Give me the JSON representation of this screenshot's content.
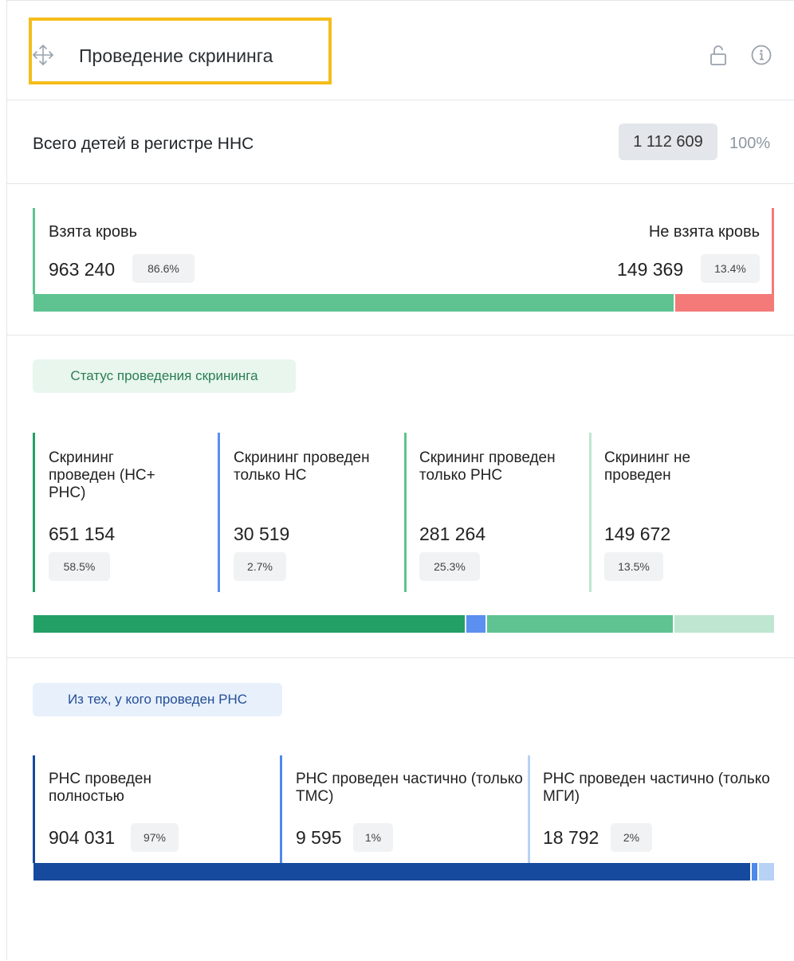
{
  "header": {
    "title": "Проведение скрининга",
    "icons": [
      "move-icon",
      "unlock-icon",
      "info-icon"
    ]
  },
  "total": {
    "label": "Всего детей в регистре ННС",
    "value": "1 112 609",
    "percent": "100%"
  },
  "blood": {
    "taken": {
      "label": "Взята кровь",
      "value": "963 240",
      "percent": "86.6%",
      "share": 0.866,
      "color": "#5ec391"
    },
    "not_taken": {
      "label": "Не взята кровь",
      "value": "149 369",
      "percent": "13.4%",
      "share": 0.134,
      "color": "#f47a7a"
    }
  },
  "screening_status": {
    "tag": "Статус проведения скрининга",
    "cards": [
      {
        "label": "Скрининг проведен (НС+ РНС)",
        "value": "651 154",
        "percent": "58.5%",
        "share": 0.585,
        "color": "#23a066"
      },
      {
        "label": "Скрининг проведен только НС",
        "value": "30 519",
        "percent": "2.7%",
        "share": 0.027,
        "color": "#5b8ff0"
      },
      {
        "label": "Скрининг проведен только РНС",
        "value": "281 264",
        "percent": "25.3%",
        "share": 0.253,
        "color": "#5ec391"
      },
      {
        "label": "Скрининг не проведен",
        "value": "149 672",
        "percent": "13.5%",
        "share": 0.135,
        "color": "#bfe6d0"
      }
    ]
  },
  "rns": {
    "tag": "Из тех, у кого проведен РНС",
    "cards": [
      {
        "label": "РНС проведен полностью",
        "value": "904 031",
        "percent": "97%",
        "share": 0.97,
        "color": "#154a9e"
      },
      {
        "label": "РНС проведен частично (только ТМС)",
        "value": "9 595",
        "percent": "1%",
        "share": 0.01,
        "color": "#4d89e8"
      },
      {
        "label": "РНС проведен частично (только МГИ)",
        "value": "18 792",
        "percent": "2%",
        "share": 0.02,
        "color": "#b7d2f5"
      }
    ]
  }
}
